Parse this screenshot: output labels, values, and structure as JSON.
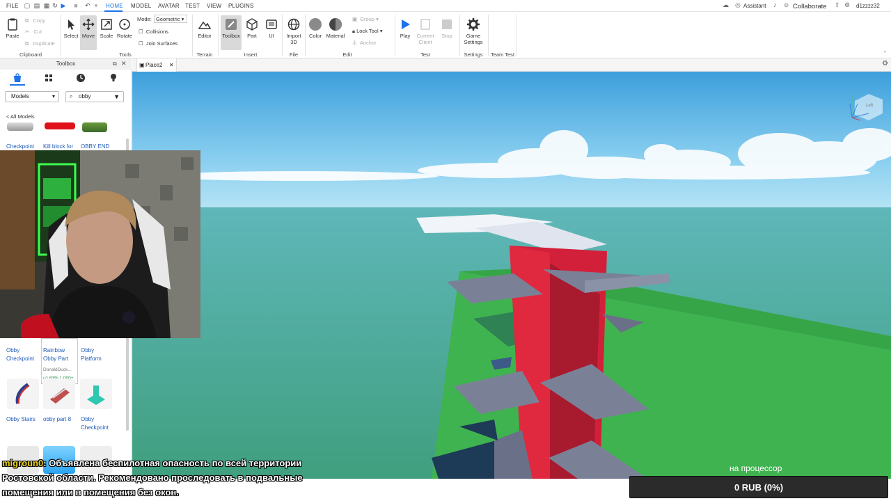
{
  "menubar": {
    "items": [
      "FILE",
      "HOME",
      "MODEL",
      "AVATAR",
      "TEST",
      "VIEW",
      "PLUGINS"
    ],
    "active": "HOME",
    "assistant": "Assistant",
    "collaborate": "Collaborate",
    "username": "d1zzzz32"
  },
  "ribbon": {
    "clipboard": {
      "paste": "Paste",
      "copy": "Copy",
      "cut": "Cut",
      "duplicate": "Duplicate",
      "label": "Clipboard"
    },
    "tools": {
      "select": "Select",
      "move": "Move",
      "scale": "Scale",
      "rotate": "Rotate",
      "mode_label": "Mode:",
      "mode_value": "Geometric",
      "collisions": "Collisions",
      "join_surfaces": "Join Surfaces",
      "label": "Tools"
    },
    "terrain": {
      "editor": "Editor",
      "label": "Terrain"
    },
    "insert": {
      "toolbox": "Toolbox",
      "part": "Part",
      "ui": "UI",
      "label": "Insert"
    },
    "file": {
      "import3d": "Import 3D",
      "label": "File"
    },
    "edit": {
      "color": "Color",
      "material": "Material",
      "group": "Group",
      "lock_tool": "Lock Tool",
      "anchor": "Anchor",
      "label": "Edit"
    },
    "test": {
      "play": "Play",
      "current_client": "Current Client",
      "stop": "Stop",
      "label": "Test"
    },
    "settings": {
      "game_settings": "Game Settings",
      "label": "Settings"
    },
    "team_test": {
      "label": "Team Test"
    }
  },
  "toolbox": {
    "title": "Toolbox",
    "category": "Models",
    "search": "obby",
    "back": "< All Models",
    "row1": [
      "Checkpoint",
      "Kill block for",
      "OBBY END"
    ],
    "row2": [
      "Obby Checkpoint",
      "Rainbow Obby Part",
      "Obby Platform"
    ],
    "row2_creator": "DonaldDuck...",
    "row2_rating": "83% 1,000+",
    "row3": [
      "Obby Stairs",
      "obby part 8",
      "Obby Checkpoint"
    ]
  },
  "tabs": {
    "place": "Place2"
  },
  "viewcube": {
    "label": "Left"
  },
  "colors": {
    "accent": "#1a73e8",
    "kill_red": "#d3203a",
    "part_gray": "#7a8197",
    "grass": "#3fb34f",
    "sky": "#5ab7e4"
  },
  "chat": {
    "user": "migroun0",
    "line1": ": Объявлена беспилотная опасность по всей территории",
    "line2": "Ростовской области. Рекомендовано проследовать в подвальные",
    "line3": "помещения или в помещения без окон."
  },
  "overlay": {
    "cpu_label": "на процессор",
    "donate": "0 RUB (0%)"
  }
}
